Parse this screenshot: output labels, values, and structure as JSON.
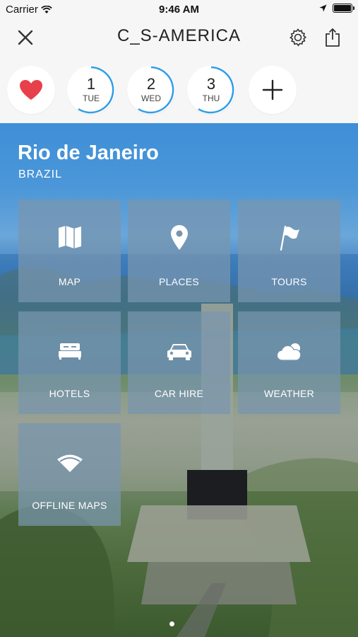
{
  "status_bar": {
    "carrier": "Carrier",
    "time": "9:46 AM"
  },
  "nav": {
    "title": "C_S-AMERICA"
  },
  "days": [
    {
      "num": "1",
      "dow": "TUE"
    },
    {
      "num": "2",
      "dow": "WED"
    },
    {
      "num": "3",
      "dow": "THU"
    }
  ],
  "city": {
    "name": "Rio de Janeiro",
    "country": "BRAZIL"
  },
  "tiles": [
    {
      "label": "MAP"
    },
    {
      "label": "PLACES"
    },
    {
      "label": "TOURS"
    },
    {
      "label": "HOTELS"
    },
    {
      "label": "CAR HIRE"
    },
    {
      "label": "WEATHER"
    },
    {
      "label": "OFFLINE MAPS"
    }
  ],
  "colors": {
    "accent": "#2f9ee8",
    "favorite": "#e8404a"
  },
  "icons": {
    "map": "folded-map-icon",
    "places": "location-pin-icon",
    "tours": "flag-icon",
    "hotels": "bed-icon",
    "car_hire": "car-icon",
    "weather": "cloud-sun-icon",
    "offline_maps": "wifi-icon"
  }
}
